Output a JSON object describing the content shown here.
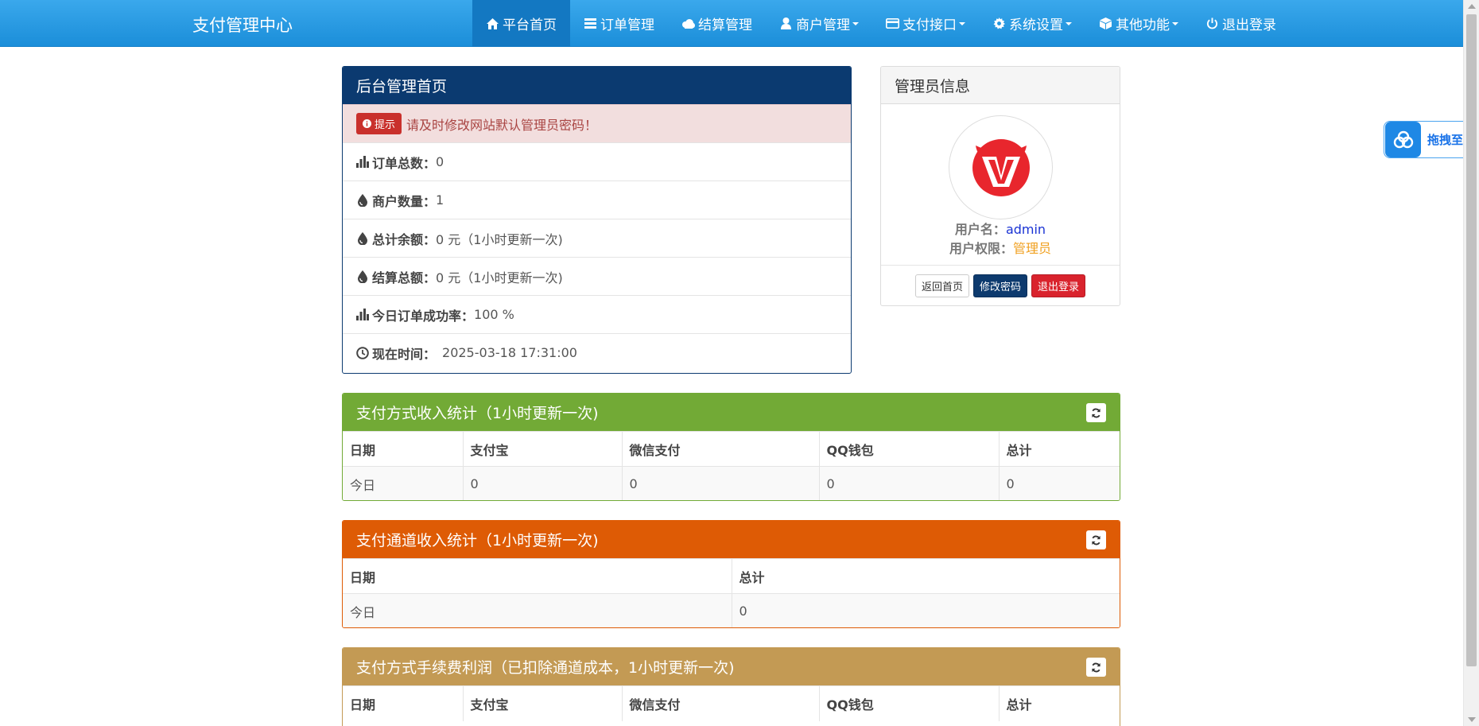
{
  "nav": {
    "brand": "支付管理中心",
    "items": [
      {
        "label": "平台首页",
        "icon": "home-icon"
      },
      {
        "label": "订单管理",
        "icon": "list-icon"
      },
      {
        "label": "结算管理",
        "icon": "cloud-icon"
      },
      {
        "label": "商户管理",
        "icon": "user-icon"
      },
      {
        "label": "支付接口",
        "icon": "credit-card-icon"
      },
      {
        "label": "系统设置",
        "icon": "gear-icon"
      },
      {
        "label": "其他功能",
        "icon": "cube-icon"
      },
      {
        "label": "退出登录",
        "icon": "power-icon"
      }
    ]
  },
  "home_panel": {
    "title": "后台管理首页",
    "alert": {
      "badge": "提示",
      "text": "请及时修改网站默认管理员密码！"
    },
    "stats": [
      {
        "label": "订单总数：",
        "value": "0",
        "icon": "bar-chart-icon"
      },
      {
        "label": "商户数量：",
        "value": "1",
        "icon": "drop-icon"
      },
      {
        "label": "总计余额：",
        "value": "0 元（1小时更新一次)",
        "icon": "drop-icon"
      },
      {
        "label": "结算总额：",
        "value": "0 元（1小时更新一次)",
        "icon": "drop-icon"
      },
      {
        "label": "今日订单成功率：",
        "value": "100 %",
        "icon": "bar-chart-icon"
      },
      {
        "label": "现在时间：",
        "value": "2025-03-18 17:31:00",
        "icon": "clock-icon"
      }
    ]
  },
  "admin_panel": {
    "title": "管理员信息",
    "username_label": "用户名：",
    "username": "admin",
    "role_label": "用户权限：",
    "role": "管理员",
    "buttons": {
      "home": "返回首页",
      "change_password": "修改密码",
      "logout": "退出登录"
    }
  },
  "pay_method_income": {
    "title": "支付方式收入统计（1小时更新一次)",
    "columns": [
      "日期",
      "支付宝",
      "微信支付",
      "QQ钱包",
      "总计"
    ],
    "rows": [
      [
        "今日",
        "0",
        "0",
        "0",
        "0"
      ]
    ]
  },
  "channel_income": {
    "title": "支付通道收入统计（1小时更新一次)",
    "columns": [
      "日期",
      "总计"
    ],
    "rows": [
      [
        "今日",
        "0"
      ]
    ]
  },
  "fee_profit": {
    "title": "支付方式手续费利润（已扣除通道成本，1小时更新一次)",
    "columns": [
      "日期",
      "支付宝",
      "微信支付",
      "QQ钱包",
      "总计"
    ]
  },
  "float_widget": {
    "label": "拖拽至此"
  },
  "colors": {
    "navbar": "#1b8ed9",
    "home_header": "#0b3a70",
    "green_header": "#72aa36",
    "orange_header": "#de5b05",
    "tan_header": "#c39a54"
  }
}
